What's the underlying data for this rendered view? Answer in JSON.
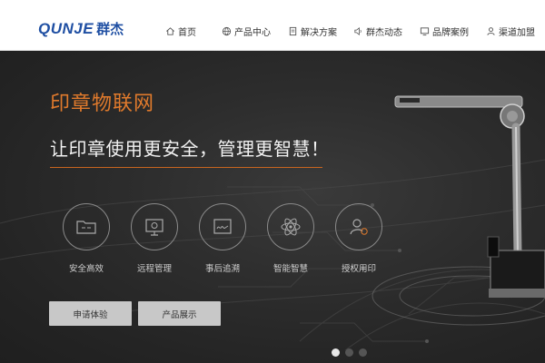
{
  "brand": {
    "logo_latin": "QUNJE",
    "logo_cn": "群杰",
    "color": "#1f4fa3"
  },
  "nav": {
    "items": [
      {
        "label": "首页",
        "icon": "home-icon"
      },
      {
        "label": "产品中心",
        "icon": "globe-icon"
      },
      {
        "label": "解决方案",
        "icon": "document-icon"
      },
      {
        "label": "群杰动态",
        "icon": "speaker-icon"
      },
      {
        "label": "品牌案例",
        "icon": "monitor-icon"
      },
      {
        "label": "渠道加盟",
        "icon": "user-icon"
      }
    ]
  },
  "hero": {
    "title": "印章物联网",
    "subtitle": "让印章使用更安全，管理更智慧！",
    "accent_color": "#e07a2c",
    "features": [
      {
        "label": "安全高效",
        "icon": "folder-icon"
      },
      {
        "label": "远程管理",
        "icon": "remote-monitor-icon"
      },
      {
        "label": "事后追溯",
        "icon": "signature-icon"
      },
      {
        "label": "智能智慧",
        "icon": "atom-icon"
      },
      {
        "label": "授权用印",
        "icon": "user-stamp-icon"
      }
    ],
    "buttons": {
      "trial": "申请体验",
      "products": "产品展示"
    },
    "carousel": {
      "slides": 3,
      "active": 1
    }
  }
}
